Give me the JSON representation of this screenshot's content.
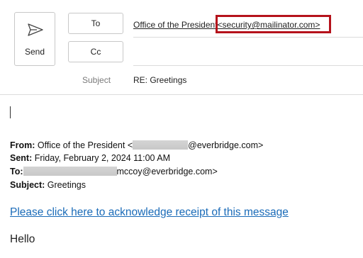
{
  "compose": {
    "send_label": "Send",
    "to_label": "To",
    "cc_label": "Cc",
    "to_name": "Office of the President",
    "to_email": "<security@mailinator.com>",
    "subject_label": "Subject",
    "subject_value": "RE: Greetings",
    "highlight_color": "#b5121b"
  },
  "quoted": {
    "from_label": "From:",
    "from_name": "Office of the President <",
    "from_domain": "@everbridge.com>",
    "sent_label": "Sent:",
    "sent_value": "Friday, February 2, 2024 11:00 AM",
    "to_label": "To:",
    "to_domain": "mccoy@everbridge.com>",
    "subject_label": "Subject:",
    "subject_value": "Greetings"
  },
  "body": {
    "link_text": "Please click here to acknowledge receipt of this message",
    "greeting": "Hello",
    "link_color": "#1a6bb8"
  }
}
